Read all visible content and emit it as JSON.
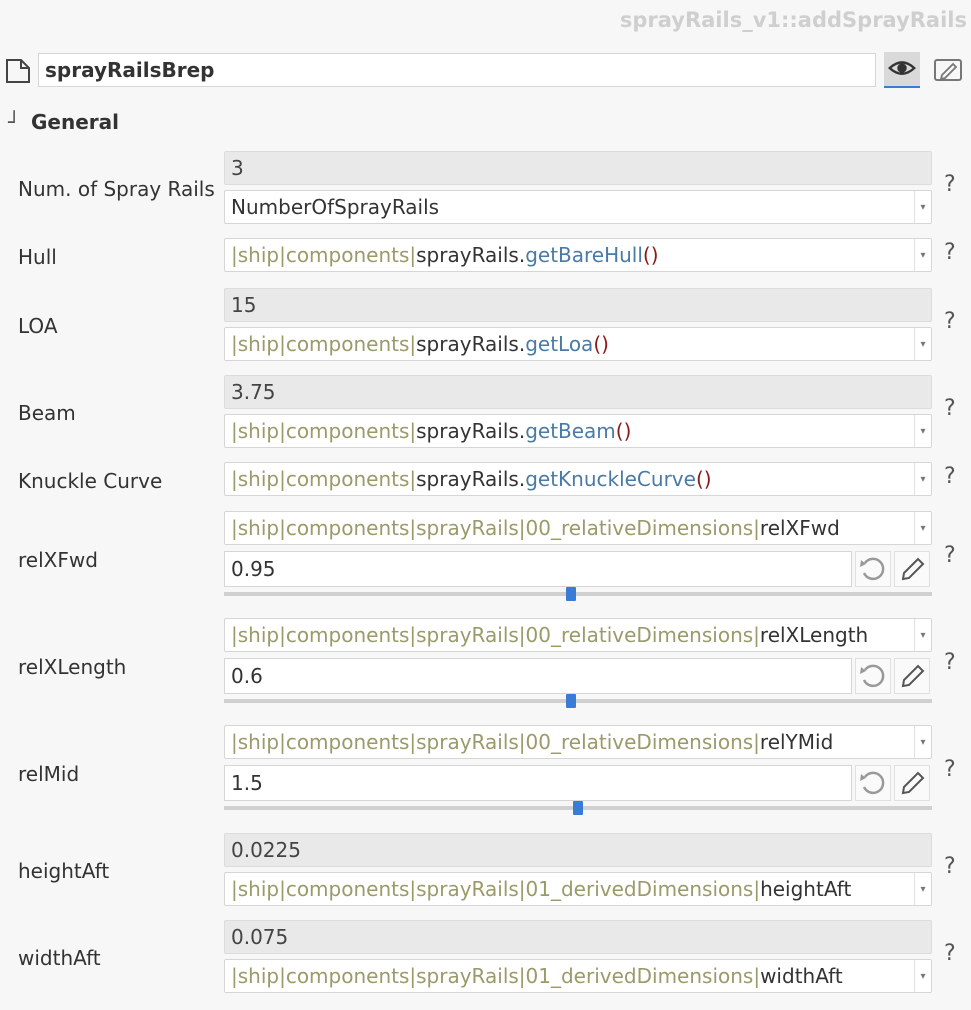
{
  "header": {
    "title": "sprayRails_v1::addSprayRails"
  },
  "name_field": {
    "value": "sprayRailsBrep"
  },
  "section": {
    "title": "General"
  },
  "rows": {
    "num": {
      "label": "Num. of Spray Rails",
      "value": "3",
      "expr": "NumberOfSprayRails"
    },
    "hull": {
      "label": "Hull",
      "p1": "|ship|components|",
      "obj": "sprayRails.",
      "fn": "getBareHull",
      "paren": "()"
    },
    "loa": {
      "label": "LOA",
      "value": "15",
      "p1": "|ship|components|",
      "obj": "sprayRails.",
      "fn": "getLoa",
      "paren": "()"
    },
    "beam": {
      "label": "Beam",
      "value": "3.75",
      "p1": "|ship|components|",
      "obj": "sprayRails.",
      "fn": "getBeam",
      "paren": "()"
    },
    "knuckle": {
      "label": "Knuckle Curve",
      "p1": "|ship|components|",
      "obj": "sprayRails.",
      "fn": "getKnuckleCurve",
      "paren": "()"
    },
    "relxfwd": {
      "label": "relXFwd",
      "p1": "|ship|components|sprayRails|00_relativeDimensions|",
      "var": "relXFwd",
      "value": "0.95",
      "slider_fraction": 0.49
    },
    "relxlength": {
      "label": "relXLength",
      "p1": "|ship|components|sprayRails|00_relativeDimensions|",
      "var": "relXLength",
      "value": "0.6",
      "slider_fraction": 0.49
    },
    "relmid": {
      "label": "relMid",
      "p1": "|ship|components|sprayRails|00_relativeDimensions|",
      "var": "relYMid",
      "value": "1.5",
      "slider_fraction": 0.5
    },
    "heightaft": {
      "label": "heightAft",
      "value": "0.0225",
      "p1": "|ship|components|sprayRails|01_derivedDimensions|",
      "var": "heightAft"
    },
    "widthaft": {
      "label": "widthAft",
      "value": "0.075",
      "p1": "|ship|components|sprayRails|01_derivedDimensions|",
      "var": "widthAft"
    }
  },
  "help": "?",
  "icons": {
    "doc": "document-icon",
    "eye": "eye-icon",
    "edit": "edit-icon",
    "reset": "reset-icon",
    "pencil": "pencil-icon",
    "arrow": "dropdown-arrow-icon",
    "section": "collapse-icon"
  },
  "colors": {
    "accent": "#3a7bd5",
    "path": "#9a9a6a",
    "method": "#4a7aa6",
    "paren": "#8b1a1a"
  }
}
